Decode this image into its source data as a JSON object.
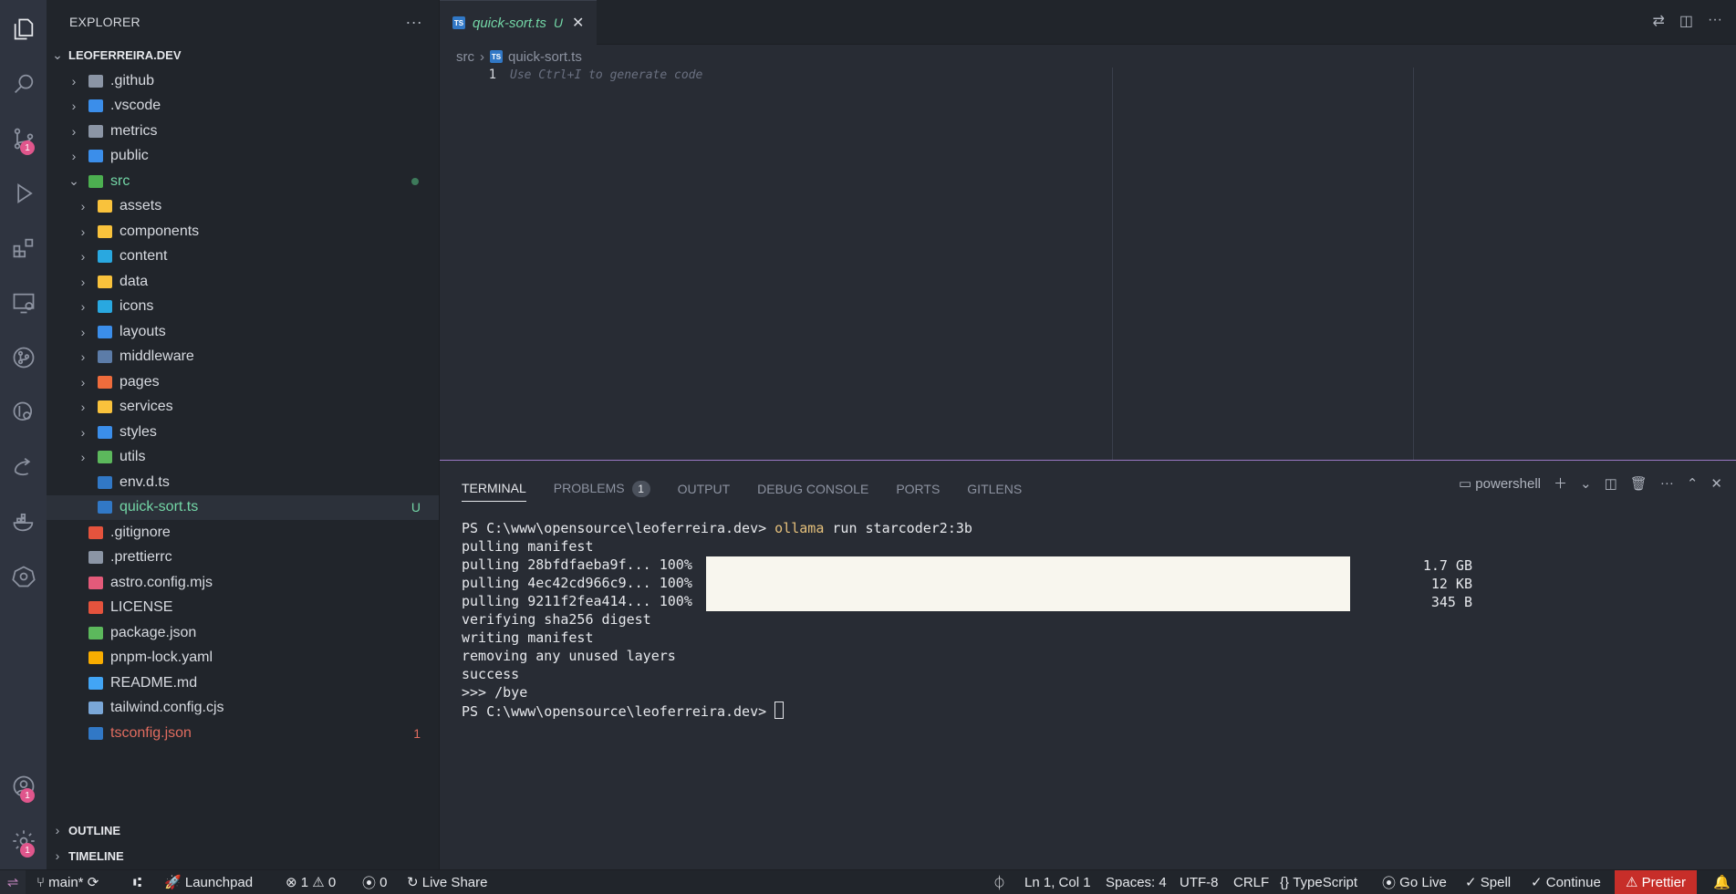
{
  "activity_bar": {
    "source_control_badge": "1",
    "accounts_badge": "1",
    "manage_badge": "1"
  },
  "sidebar": {
    "title": "EXPLORER",
    "more": "···",
    "workspace": "LEOFERREIRA.DEV",
    "items": [
      {
        "label": ".github",
        "type": "folder",
        "color": "#8b95a5"
      },
      {
        "label": ".vscode",
        "type": "folder",
        "color": "#3b8eea"
      },
      {
        "label": "metrics",
        "type": "folder",
        "color": "#8b95a5"
      },
      {
        "label": "public",
        "type": "folder",
        "color": "#3b8eea"
      },
      {
        "label": "src",
        "type": "folder-open",
        "color": "#4caf50"
      },
      {
        "label": "assets",
        "type": "folder",
        "color": "#f9c23c"
      },
      {
        "label": "components",
        "type": "folder",
        "color": "#f9c23c"
      },
      {
        "label": "content",
        "type": "folder",
        "color": "#29a8e0"
      },
      {
        "label": "data",
        "type": "folder",
        "color": "#f9c23c"
      },
      {
        "label": "icons",
        "type": "folder",
        "color": "#29a8e0"
      },
      {
        "label": "layouts",
        "type": "folder",
        "color": "#3b8eea"
      },
      {
        "label": "middleware",
        "type": "folder",
        "color": "#5c7ca8"
      },
      {
        "label": "pages",
        "type": "folder",
        "color": "#ef6c3c"
      },
      {
        "label": "services",
        "type": "folder",
        "color": "#f9c23c"
      },
      {
        "label": "styles",
        "type": "folder",
        "color": "#3b8eea"
      },
      {
        "label": "utils",
        "type": "folder",
        "color": "#5cb85c"
      },
      {
        "label": "env.d.ts",
        "type": "file",
        "color": "#3178c6"
      },
      {
        "label": "quick-sort.ts",
        "type": "file",
        "color": "#3178c6",
        "decoration": "U"
      },
      {
        "label": ".gitignore",
        "type": "file",
        "color": "#e5533d"
      },
      {
        "label": ".prettierrc",
        "type": "file",
        "color": "#8b95a5"
      },
      {
        "label": "astro.config.mjs",
        "type": "file",
        "color": "#e45a7a"
      },
      {
        "label": "LICENSE",
        "type": "file",
        "color": "#e5533d"
      },
      {
        "label": "package.json",
        "type": "file",
        "color": "#5cb85c"
      },
      {
        "label": "pnpm-lock.yaml",
        "type": "file",
        "color": "#f9ad00"
      },
      {
        "label": "README.md",
        "type": "file",
        "color": "#42a5f5"
      },
      {
        "label": "tailwind.config.cjs",
        "type": "file",
        "color": "#7aa7d8"
      },
      {
        "label": "tsconfig.json",
        "type": "file",
        "color": "#3178c6",
        "decoration": "1"
      }
    ],
    "outline": "OUTLINE",
    "timeline": "TIMELINE"
  },
  "editor": {
    "tab_label": "quick-sort.ts",
    "tab_status": "U",
    "breadcrumb": [
      "src",
      "quick-sort.ts"
    ],
    "line_number": "1",
    "ghost_text": "Use Ctrl+I to generate code"
  },
  "panel": {
    "tabs": [
      "TERMINAL",
      "PROBLEMS",
      "OUTPUT",
      "DEBUG CONSOLE",
      "PORTS",
      "GITLENS"
    ],
    "problems_count": "1",
    "shell": "powershell",
    "terminal": {
      "prompt": "PS C:\\www\\opensource\\leoferreira.dev>",
      "command": "ollama",
      "command_args": "run starcoder2:3b",
      "lines": [
        "pulling manifest",
        "pulling 28bfdfaeba9f... 100%",
        "pulling 4ec42cd966c9... 100%",
        "pulling 9211f2fea414... 100%",
        "verifying sha256 digest",
        "writing manifest",
        "removing any unused layers",
        "success",
        ">>> /bye"
      ],
      "sizes": [
        "1.7 GB",
        "12 KB",
        "345 B"
      ],
      "progress": [
        1.0,
        1.0,
        1.0
      ],
      "final_prompt": "PS C:\\www\\opensource\\leoferreira.dev>"
    }
  },
  "statusbar": {
    "branch": "main*",
    "launchpad": "Launchpad",
    "errors": "1",
    "warnings": "0",
    "ports": "0",
    "live_share": "Live Share",
    "position": "Ln 1, Col 1",
    "spaces": "Spaces: 4",
    "encoding": "UTF-8",
    "eol": "CRLF",
    "language": "TypeScript",
    "go_live": "Go Live",
    "spell": "Spell",
    "continue": "Continue",
    "prettier": "Prettier"
  }
}
